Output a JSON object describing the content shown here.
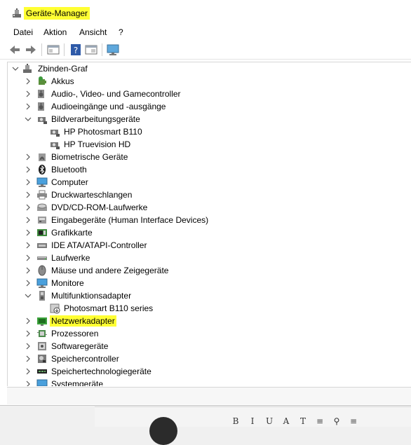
{
  "window": {
    "title": "Geräte-Manager",
    "title_highlight_color": "#ffff33"
  },
  "menu": {
    "items": [
      "Datei",
      "Aktion",
      "Ansicht",
      "?"
    ]
  },
  "toolbar": {
    "buttons": [
      "back-icon",
      "forward-icon",
      "properties-pane-icon",
      "help-icon",
      "details-pane-icon",
      "monitor-scan-icon"
    ]
  },
  "tree": {
    "root": "Zbinden-Graf",
    "rows": [
      {
        "label": "Akkus",
        "icon": "battery-icon",
        "expanded": false
      },
      {
        "label": "Audio-, Video- und Gamecontroller",
        "icon": "speaker-icon",
        "expanded": false
      },
      {
        "label": "Audioeingänge und -ausgänge",
        "icon": "speaker-icon",
        "expanded": false
      },
      {
        "label": "Bildverarbeitungsgeräte",
        "icon": "camera-icon",
        "expanded": true
      },
      {
        "label": "HP Photosmart B110",
        "icon": "camera-icon",
        "child": true
      },
      {
        "label": "HP Truevision HD",
        "icon": "camera-icon",
        "child": true
      },
      {
        "label": "Biometrische Geräte",
        "icon": "fingerprint-icon",
        "expanded": false
      },
      {
        "label": "Bluetooth",
        "icon": "bluetooth-icon",
        "expanded": false
      },
      {
        "label": "Computer",
        "icon": "computer-icon",
        "expanded": false
      },
      {
        "label": "Druckwarteschlangen",
        "icon": "printer-icon",
        "expanded": false
      },
      {
        "label": "DVD/CD-ROM-Laufwerke",
        "icon": "disc-drive-icon",
        "expanded": false
      },
      {
        "label": "Eingabegeräte (Human Interface Devices)",
        "icon": "hid-icon",
        "expanded": false
      },
      {
        "label": "Grafikkarte",
        "icon": "display-adapter-icon",
        "expanded": false
      },
      {
        "label": "IDE ATA/ATAPI-Controller",
        "icon": "ide-controller-icon",
        "expanded": false
      },
      {
        "label": "Laufwerke",
        "icon": "disk-drive-icon",
        "expanded": false
      },
      {
        "label": "Mäuse und andere Zeigegeräte",
        "icon": "mouse-icon",
        "expanded": false
      },
      {
        "label": "Monitore",
        "icon": "monitor-icon",
        "expanded": false
      },
      {
        "label": "Multifunktionsadapter",
        "icon": "multifunction-icon",
        "expanded": true
      },
      {
        "label": "Photosmart B110 series",
        "icon": "multifunction-device-icon",
        "child": true
      },
      {
        "label": "Netzwerkadapter",
        "icon": "network-adapter-icon",
        "expanded": false,
        "highlight": true
      },
      {
        "label": "Prozessoren",
        "icon": "processor-icon",
        "expanded": false
      },
      {
        "label": "Softwaregeräte",
        "icon": "software-device-icon",
        "expanded": false
      },
      {
        "label": "Speichercontroller",
        "icon": "storage-controller-icon",
        "expanded": false
      },
      {
        "label": "Speichertechnologiegeräte",
        "icon": "memory-tech-icon",
        "expanded": false
      },
      {
        "label": "Systemgeräte",
        "icon": "system-device-icon",
        "expanded": false
      }
    ]
  },
  "background_app": {
    "format_buttons": [
      "B",
      "I",
      "U",
      "A",
      "T",
      "≡",
      "⚲",
      "≡"
    ]
  }
}
